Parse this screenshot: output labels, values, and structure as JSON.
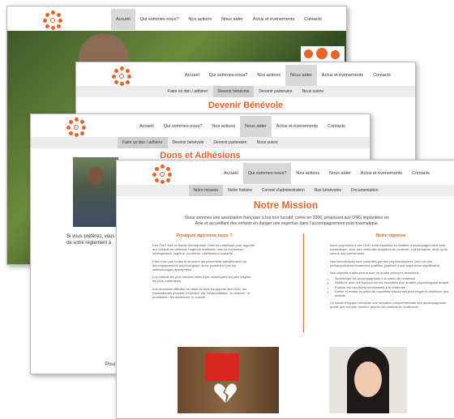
{
  "nav_items": [
    "Accueil",
    "Qui sommes-nous?",
    "Nos actions",
    "Nous aider",
    "Actus et événements",
    "Contacts"
  ],
  "sub_nav_aider": [
    "Faire un don / adhérer",
    "Devenir bénévole",
    "Devenir partenaire",
    "Nous suivre"
  ],
  "sub_nav_qui": [
    "Notre mission",
    "Notre histoire",
    "Conseil d'administration",
    "Nos bénévoles",
    "Documentation"
  ],
  "titles": {
    "benevole": "Devenir Bénévole",
    "dons": "Dons et Adhésions",
    "mission": "Notre Mission"
  },
  "mission": {
    "intro_line1": "Nous sommes une association française à but non lucratif, créée en 2006, proposant aux ONG implantées en",
    "intro_line2": "Asie et accueillant des enfants en danger une expertise dans l'accompagnement post-traumatique.",
    "left_heading": "Pourquoi agissons-nous ?",
    "right_heading": "Notre réponse",
    "left_col": [
      "Des ONG font un travail remarquable. Elles se mobilisent pour apporter aux enfants en détresse l'urgence matérielle dont ils ont besoin : hébergement, hygiène, nourriture, habillement, scolarité ...",
      "Elles n'ont pas toutes la structure qui permettrait parallèlement un accompagnement psychologique ou ne possèdent pas les méthodologies appropriées.",
      "Les enfants les plus touchés restent par conséquent les plus fragiles, les plus vulnérables.",
      "Aux moments difficiles, en dépit de tous les apports des ONG, les traumatismes peuvent s'exprimer par l'automutilation, la violence, la prostitution, les addictions, le suicide."
    ],
    "right_col": [
      "Nous proposons à ces ONG notre expertise en matière d'accompagnement post-traumatique, avec des méthodes adaptées au contexte, à la demande, ainsi qu'au cursus des intervenants.",
      "Nos interventions sont conduites par des psychocliniciens (rien) ou des pédopsychiatres hautement qualifiés, justifiant d'une expérience significative.",
      "Nos objectifs s'articulent autour de quatre principes essentiels :"
    ],
    "objectives": [
      "Sensibiliser les accompagnants à la notion de résilience",
      "Réfléchir avec les équipes sur les modalités d'un soutien psychologique adapté",
      "Évaluer les conditions nécessaires à la résilience",
      "Définir et mettre en place de nouvelles ressources pour étayer la résilience des enfants"
    ],
    "closing": "Ce travail d'équipe nécessite une formation complémentaire des accompagnants, quelle que soit leur fonction auprès des enfants en souffrance."
  },
  "dons_text_1": "Si vous préférez, vous",
  "dons_text_2": "de votre règlement à",
  "dons_footer": "Pour",
  "colors": {
    "accent": "#e8632a",
    "nav_active": "#d8d8d8",
    "subnav_bg": "#ececec"
  }
}
